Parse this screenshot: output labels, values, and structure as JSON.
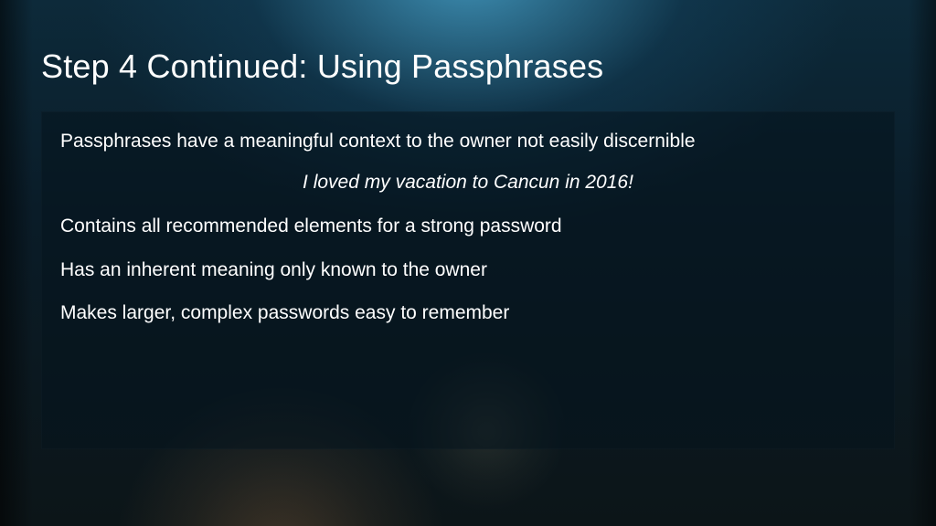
{
  "title": "Step 4 Continued: Using Passphrases",
  "panel": {
    "line1": "Passphrases have a meaningful context to the owner not easily discernible",
    "example": "I loved my vacation to Cancun in 2016!",
    "line2": "Contains all recommended elements for a strong password",
    "line3": "Has an inherent meaning only known to the owner",
    "line4": "Makes larger, complex passwords easy to remember"
  }
}
